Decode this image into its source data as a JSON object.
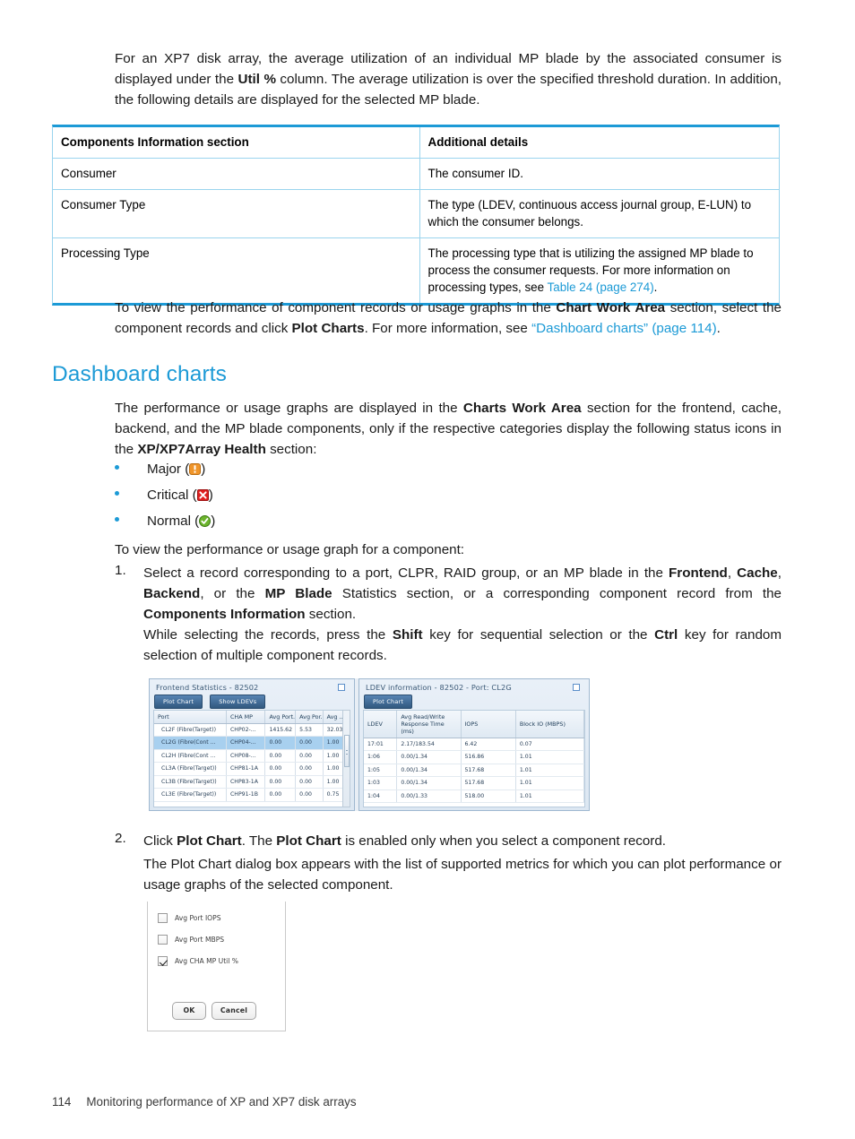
{
  "intro": {
    "para_html": "For an XP7 disk array, the average utilization of an individual MP blade by the associated consumer is displayed under the <b>Util %</b> column. The average utilization is over the specified threshold duration. In addition, the following details are displayed for the selected MP blade."
  },
  "components_table": {
    "headers": [
      "Components Information section",
      "Additional details"
    ],
    "rows": [
      {
        "name": "Consumer",
        "detail_html": "The consumer ID."
      },
      {
        "name": "Consumer Type",
        "detail_html": "The type (LDEV, continuous access journal group, E-LUN) to which the consumer belongs."
      },
      {
        "name": "Processing Type",
        "detail_html": "The processing type that is utilizing the assigned MP blade to process the consumer requests. For more information on processing types, see <span class=\"link\">Table 24 (page 274)</span>."
      }
    ],
    "accent_color": "#1c9ad6",
    "border_color": "#9ad4ee"
  },
  "plot_charts_para": {
    "html": "To view the performance of component records or usage graphs in the <b>Chart Work Area</b> section, select the component records and click <b>Plot Charts</b>. For more information, see <span class=\"link\">&ldquo;Dashboard charts&rdquo; (page 114)</span>."
  },
  "section": {
    "heading": "Dashboard charts",
    "heading_color": "#1c9ad6",
    "intro_html": "The performance or usage graphs are displayed in the <b>Charts Work Area</b> section for the frontend, cache, backend, and the MP blade components, only if the respective categories display the following status icons in the <b>XP/XP7Array Health</b> section:"
  },
  "status_bullets": [
    {
      "label_prefix": "Major",
      "icon": "warning-icon",
      "color": "#f0952a"
    },
    {
      "label_prefix": "Critical",
      "icon": "error-icon",
      "color": "#e02020"
    },
    {
      "label_prefix": "Normal",
      "icon": "ok-icon",
      "color": "#6cb42c"
    }
  ],
  "steps_intro": "To view the performance or usage graph for a component:",
  "steps": [
    {
      "number": "1.",
      "html": "Select a record corresponding to a port, CLPR, RAID group, or an MP blade in the <b>Frontend</b>, <b>Cache</b>, <b>Backend</b>, or the <b>MP Blade</b> Statistics section, or a corresponding component record from the <b>Components Information</b> section.",
      "sub_html": "While selecting the records, press the <b>Shift</b> key for sequential selection or the <b>Ctrl</b> key for random selection of multiple component records."
    },
    {
      "number": "2.",
      "html": "Click <b>Plot Chart</b>. The <b>Plot Chart</b> is enabled only when you select a component record.",
      "sub_html": "The Plot Chart dialog box appears with the list of supported metrics for which you can plot performance or usage graphs of the selected component."
    }
  ],
  "app_screenshot": {
    "frontend_panel": {
      "title": "Frontend Statistics - 82502",
      "buttons": [
        "Plot Chart",
        "Show LDEVs"
      ],
      "columns": [
        "Port",
        "CHA MP",
        "Avg Port...",
        "Avg Por...",
        "Avg ..."
      ],
      "rows": [
        {
          "selected": false,
          "cells": [
            "CL2F (Fibre(Target))",
            "CHP02-...",
            "1415.62",
            "5.53",
            "32.03"
          ]
        },
        {
          "selected": true,
          "cells": [
            "CL2G (Fibre(Cont ...",
            "CHP04-...",
            "0.00",
            "0.00",
            "1.00"
          ]
        },
        {
          "selected": false,
          "cells": [
            "CL2H (Fibre(Cont ...",
            "CHP08-...",
            "0.00",
            "0.00",
            "1.00"
          ]
        },
        {
          "selected": false,
          "cells": [
            "CL3A (Fibre(Target))",
            "CHP81-1A",
            "0.00",
            "0.00",
            "1.00"
          ]
        },
        {
          "selected": false,
          "cells": [
            "CL3B (Fibre(Target))",
            "CHP83-1A",
            "0.00",
            "0.00",
            "1.00"
          ]
        },
        {
          "selected": false,
          "cells": [
            "CL3E (Fibre(Target))",
            "CHP91-1B",
            "0.00",
            "0.00",
            "0.75"
          ]
        }
      ]
    },
    "ldev_panel": {
      "title": "LDEV information  - 82502  - Port: CL2G",
      "buttons": [
        "Plot Chart"
      ],
      "columns": [
        "LDEV",
        "Avg Read/Write Response Time (ms)",
        "IOPS",
        "Block IO (MBPS)"
      ],
      "rows": [
        {
          "cells": [
            "17:01",
            "2.17/183.54",
            "6.42",
            "0.07"
          ]
        },
        {
          "cells": [
            "1:06",
            "0.00/1.34",
            "516.86",
            "1.01"
          ]
        },
        {
          "cells": [
            "1:05",
            "0.00/1.34",
            "517.68",
            "1.01"
          ]
        },
        {
          "cells": [
            "1:03",
            "0.00/1.34",
            "517.68",
            "1.01"
          ]
        },
        {
          "cells": [
            "1:04",
            "0.00/1.33",
            "518.00",
            "1.01"
          ]
        }
      ]
    }
  },
  "plot_chart_dialog": {
    "options": [
      {
        "label": "Avg Port IOPS",
        "checked": false
      },
      {
        "label": "Avg Port MBPS",
        "checked": false
      },
      {
        "label": "Avg CHA MP Util %",
        "checked": true
      }
    ],
    "ok_label": "OK",
    "cancel_label": "Cancel"
  },
  "footer": {
    "page_number": "114",
    "title": "Monitoring performance of XP and XP7 disk arrays"
  }
}
